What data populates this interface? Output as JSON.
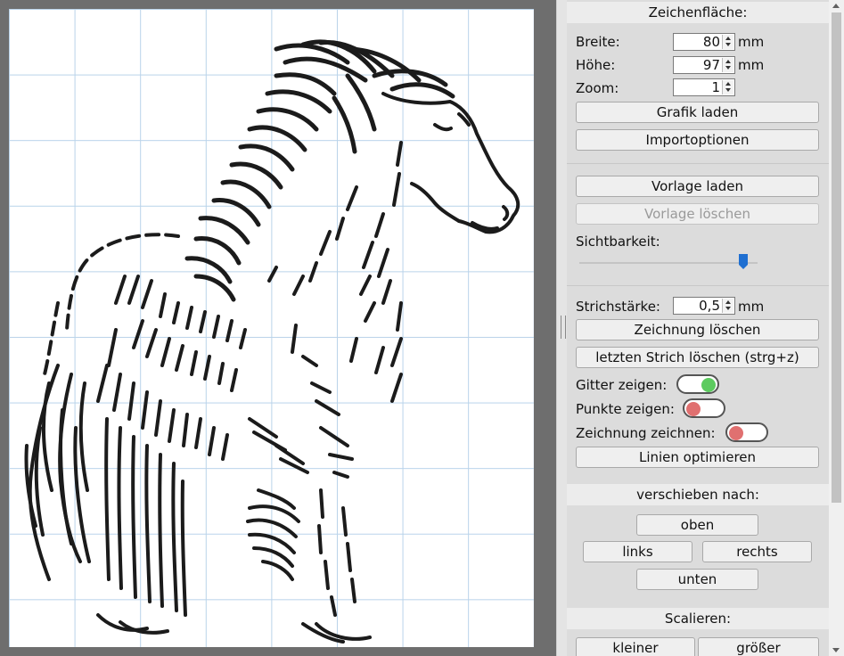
{
  "canvas_section": {
    "title": "Zeichenfläche:",
    "width_label": "Breite:",
    "width_value": "80",
    "height_label": "Höhe:",
    "height_value": "97",
    "zoom_label": "Zoom:",
    "zoom_value": "1",
    "unit": "mm",
    "load_graphic": "Grafik laden",
    "import_options": "Importoptionen"
  },
  "template_section": {
    "load_template": "Vorlage laden",
    "delete_template": "Vorlage löschen",
    "visibility_label": "Sichtbarkeit:",
    "visibility_value": 0.93
  },
  "drawing_section": {
    "stroke_label": "Strichstärke:",
    "stroke_value": "0,5",
    "unit": "mm",
    "clear_drawing": "Zeichnung löschen",
    "undo_last": "letzten Strich löschen (strg+z)",
    "show_grid_label": "Gitter zeigen:",
    "show_grid": true,
    "show_points_label": "Punkte zeigen:",
    "show_points": false,
    "draw_drawing_label": "Zeichnung zeichnen:",
    "draw_drawing": false,
    "optimize_lines": "Linien optimieren"
  },
  "move_section": {
    "title": "verschieben nach:",
    "up": "oben",
    "left": "links",
    "right": "rechts",
    "down": "unten"
  },
  "scale_section": {
    "title": "Scalieren:",
    "smaller": "kleiner",
    "bigger": "größer"
  },
  "colors": {
    "toggle_on": "#5ccb5f",
    "toggle_off": "#e07070",
    "slider_thumb": "#1f6fd1",
    "grid": "#b9d3ea"
  }
}
